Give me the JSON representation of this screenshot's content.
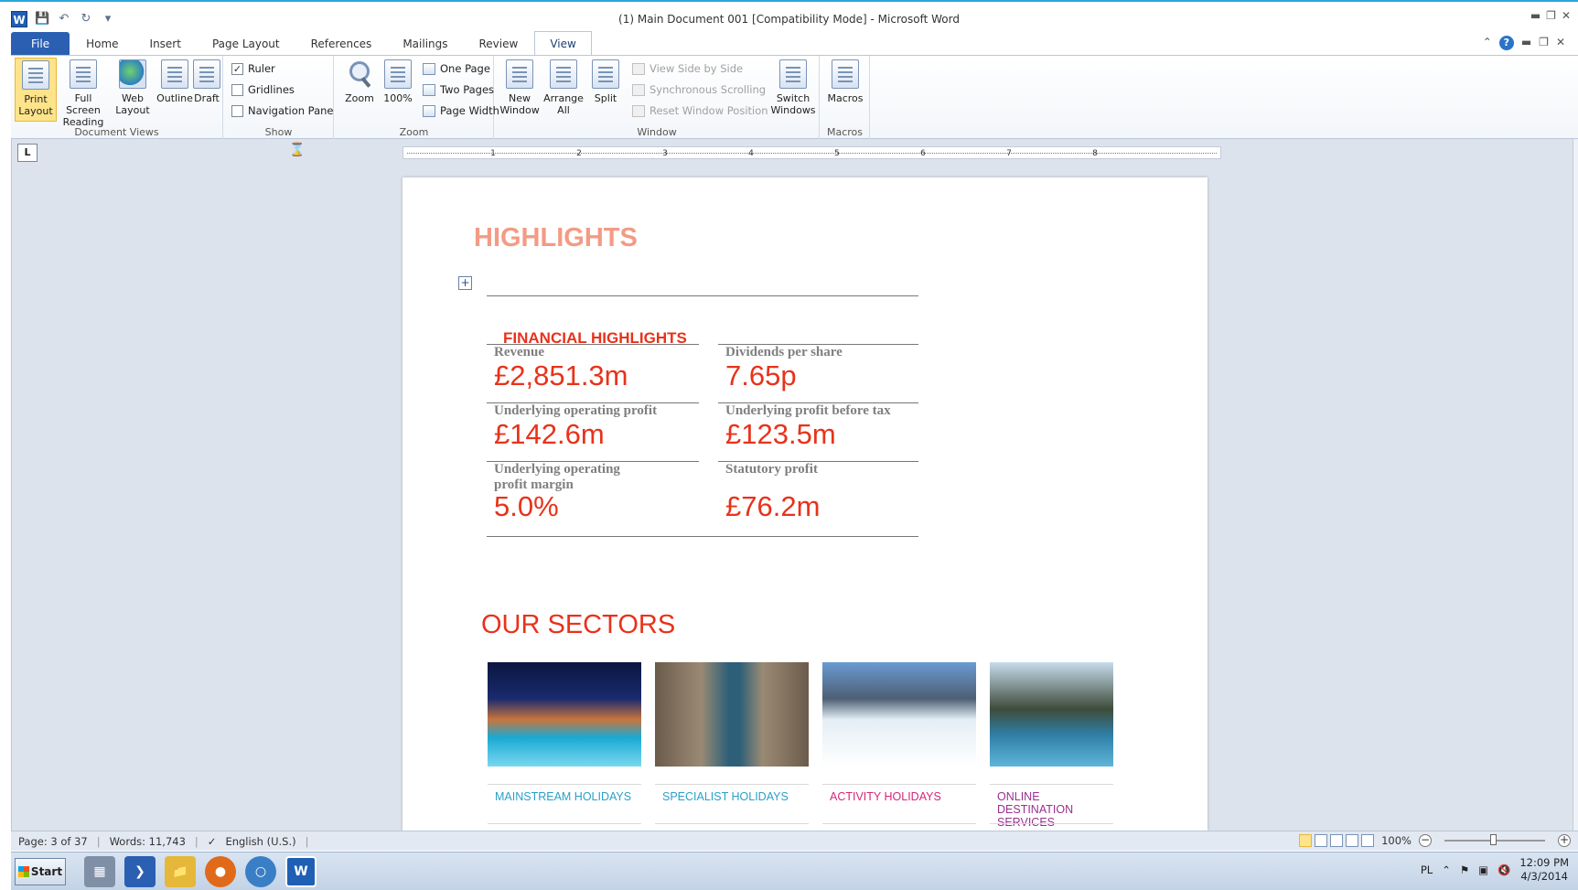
{
  "window": {
    "title": "(1) Main Document 001 [Compatibility Mode]  -  Microsoft Word"
  },
  "tabs": [
    "File",
    "Home",
    "Insert",
    "Page Layout",
    "References",
    "Mailings",
    "Review",
    "View"
  ],
  "active_tab": "View",
  "ribbon": {
    "document_views": {
      "label": "Document Views",
      "print_layout": "Print Layout",
      "full_screen_reading": "Full Screen Reading",
      "web_layout": "Web Layout",
      "outline": "Outline",
      "draft": "Draft"
    },
    "show": {
      "label": "Show",
      "ruler": "Ruler",
      "ruler_checked": true,
      "gridlines": "Gridlines",
      "gridlines_checked": false,
      "navigation_pane": "Navigation Pane",
      "navigation_pane_checked": false
    },
    "zoom": {
      "label": "Zoom",
      "zoom": "Zoom",
      "hundred": "100%",
      "one_page": "One Page",
      "two_pages": "Two Pages",
      "page_width": "Page Width"
    },
    "window_group": {
      "label": "Window",
      "new_window": "New Window",
      "arrange_all": "Arrange All",
      "split": "Split",
      "view_side_by_side": "View Side by Side",
      "synchronous_scrolling": "Synchronous Scrolling",
      "reset_window_position": "Reset Window Position",
      "switch_windows": "Switch Windows"
    },
    "macros": {
      "label": "Macros",
      "macros": "Macros"
    }
  },
  "ruler_ticks": [
    "1",
    "2",
    "3",
    "4",
    "5",
    "6",
    "7",
    "8"
  ],
  "document": {
    "highlights_title": "HIGHLIGHTS",
    "financial_title": "FINANCIAL HIGHLIGHTS",
    "metrics": [
      {
        "label": "Revenue",
        "value": "£2,851.3m"
      },
      {
        "label": "Dividends per share",
        "value": "7.65p"
      },
      {
        "label": "Underlying operating profit",
        "value": "£142.6m"
      },
      {
        "label": "Underlying profit before tax",
        "value": "£123.5m"
      },
      {
        "label": "Underlying operating profit margin",
        "value": "5.0%"
      },
      {
        "label": "Statutory profit",
        "value": "£76.2m"
      }
    ],
    "sectors_title": "OUR SECTORS",
    "sectors": [
      {
        "label": "MAINSTREAM HOLIDAYS",
        "color": "#2aa0c8"
      },
      {
        "label": "SPECIALIST HOLIDAYS",
        "color": "#2aa0c8"
      },
      {
        "label": "ACTIVITY HOLIDAYS",
        "color": "#d4267a"
      },
      {
        "label": "ONLINE DESTINATION SERVICES",
        "color": "#9a2f8f"
      }
    ],
    "accent_color": "#e8321a"
  },
  "status": {
    "page": "Page: 3 of 37",
    "words": "Words: 11,743",
    "language": "English (U.S.)",
    "zoom": "100%",
    "zoom_level": 1.0
  },
  "taskbar": {
    "start": "Start",
    "language": "PL",
    "time": "12:09 PM",
    "date": "4/3/2014",
    "apps": [
      "server-manager",
      "powershell",
      "explorer",
      "firefox",
      "app-circle",
      "word"
    ]
  }
}
